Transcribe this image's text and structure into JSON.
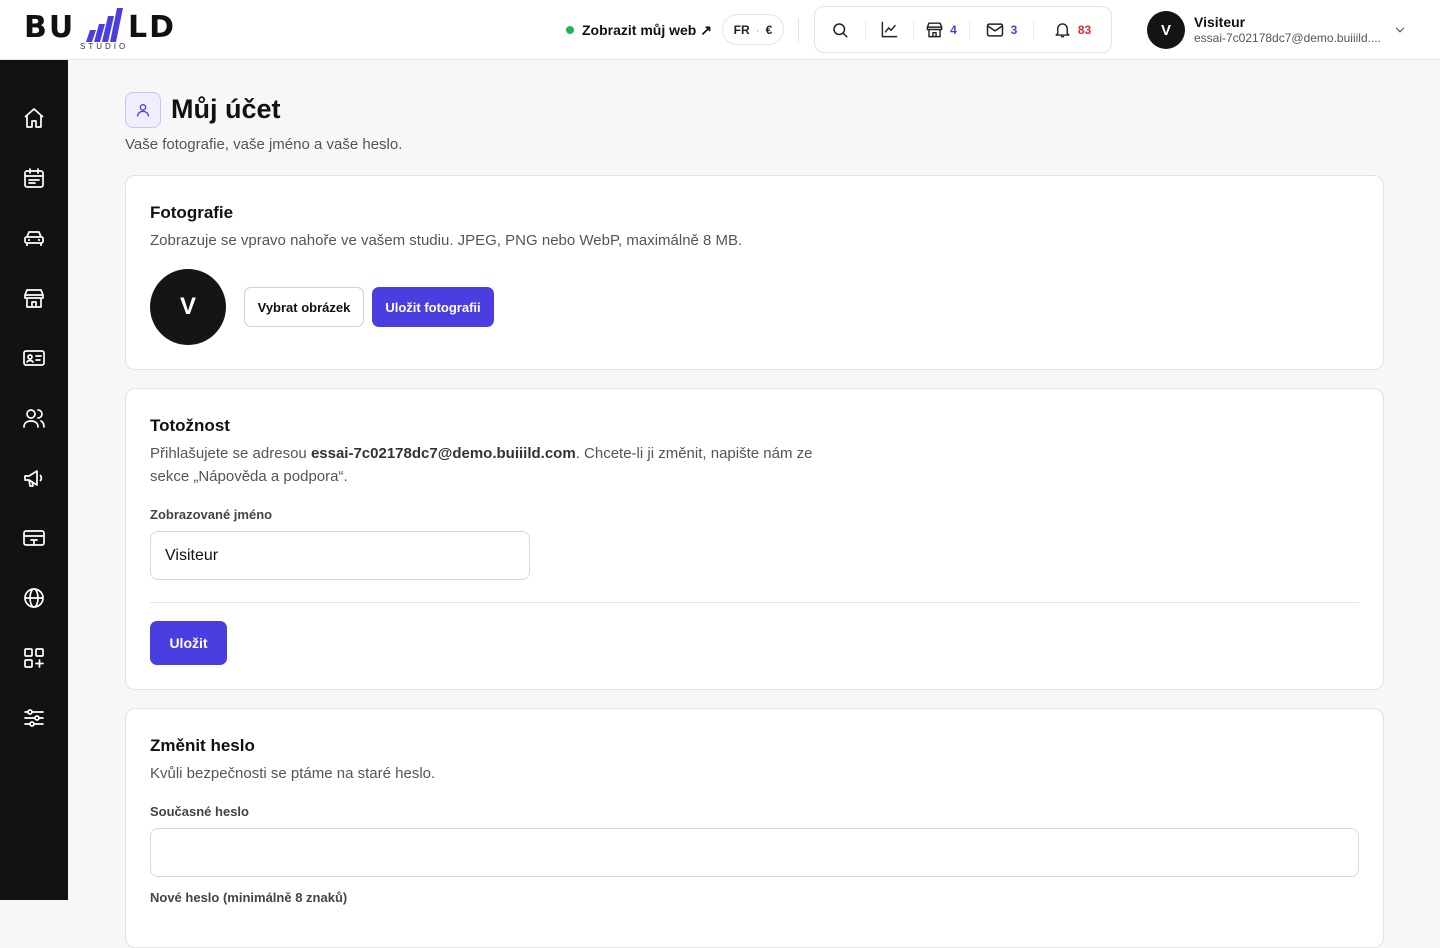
{
  "brand": {
    "left": "BU",
    "right": "LD",
    "sub": "STUDIO"
  },
  "header": {
    "view_site": "Zobrazit můj web ↗",
    "locale_lang": "FR",
    "locale_sep": "·",
    "locale_currency": "€",
    "store_count": "4",
    "mail_count": "3",
    "notif_count": "83"
  },
  "user": {
    "initial": "V",
    "name": "Visiteur",
    "email": "essai-7c02178dc7@demo.buiiild...."
  },
  "sidebar": {
    "items": [
      "home-icon",
      "calendar-icon",
      "car-icon",
      "store-icon",
      "id-card-icon",
      "users-icon",
      "megaphone-icon",
      "payment-card-icon",
      "globe-icon",
      "apps-icon",
      "settings-sliders-icon"
    ]
  },
  "page": {
    "title": "Můj účet",
    "subtitle": "Vaše fotografie, vaše jméno a vaše heslo."
  },
  "photo": {
    "title": "Fotografie",
    "desc": "Zobrazuje se vpravo nahoře ve vašem studiu. JPEG, PNG nebo WebP, maximálně 8 MB.",
    "avatar_initial": "V",
    "choose_label": "Vybrat obrázek",
    "save_label": "Uložit fotografii"
  },
  "identity": {
    "title": "Totožnost",
    "desc_pre": "Přihlašujete se adresou ",
    "email": "essai-7c02178dc7@demo.buiiild.com",
    "desc_post": ". Chcete-li ji změnit, napište nám ze sekce „Nápověda a podpora“.",
    "name_label": "Zobrazované jméno",
    "name_value": "Visiteur",
    "save_label": "Uložit"
  },
  "password": {
    "title": "Změnit heslo",
    "desc": "Kvůli bezpečnosti se ptáme na staré heslo.",
    "current_label": "Současné heslo",
    "current_value": "",
    "new_label": "Nové heslo (minimálně 8 znaků)"
  },
  "colors": {
    "accent": "#4b3ee0",
    "sidebar": "#121212",
    "online": "#22b35b",
    "alert": "#d92d2d"
  }
}
